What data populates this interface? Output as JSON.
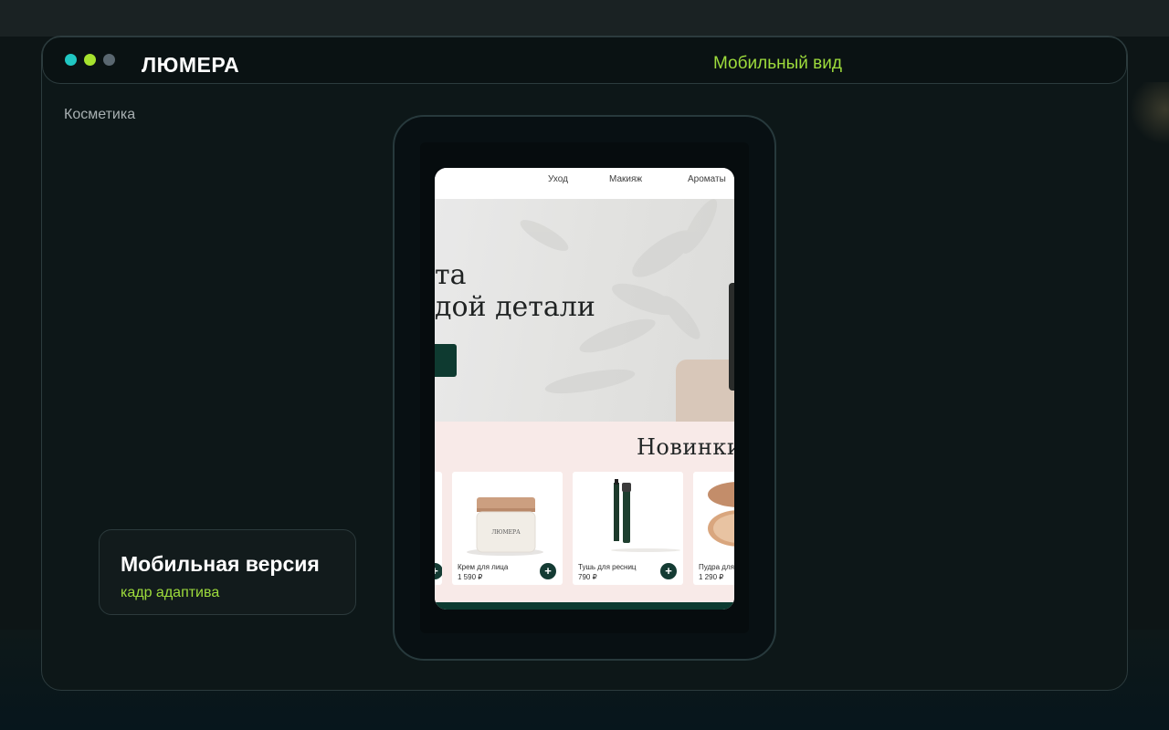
{
  "window": {
    "brand": "ЛЮМЕРА",
    "view_label": "Мобильный вид",
    "section_label": "Косметика"
  },
  "info_card": {
    "title": "Мобильная версия",
    "subtitle": "кадр адаптива"
  },
  "mobile_site": {
    "nav": [
      "Уход",
      "Макияж",
      "Ароматы"
    ],
    "hero": {
      "line1": "та",
      "line2": "дой детали"
    },
    "new_arrivals_title": "Новинки",
    "products": [
      {
        "name": "Крем для лица",
        "price": "1 590 ₽",
        "brand": "ЛЮМЕРА"
      },
      {
        "name": "Тушь для ресниц",
        "price": "790 ₽"
      },
      {
        "name": "Пудра для л",
        "price": "1 290 ₽"
      }
    ],
    "add_symbol": "+"
  },
  "colors": {
    "accent_green": "#9edc3c",
    "brand_dark_green": "#143b33",
    "dot_teal": "#20c7c3",
    "dot_lime": "#a6e22e",
    "dot_grey": "#5a6770"
  }
}
